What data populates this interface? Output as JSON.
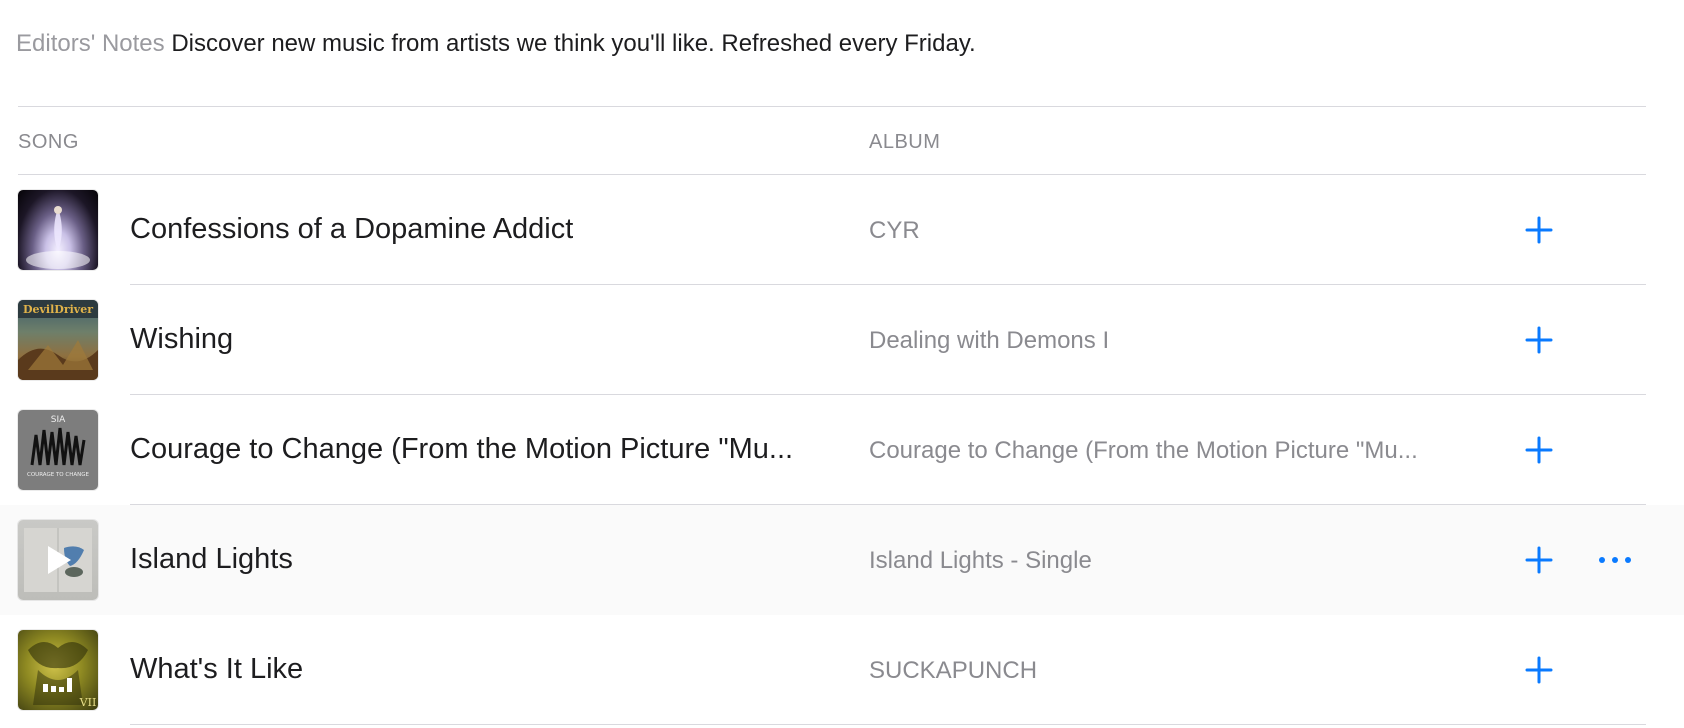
{
  "editors_notes": {
    "label": "Editors' Notes",
    "text": "Discover new music from artists we think you'll like. Refreshed every Friday."
  },
  "columns": {
    "song": "SONG",
    "album": "ALBUM"
  },
  "colors": {
    "accent": "#0a7aff",
    "secondary_text": "#8a8a8f",
    "separator": "#d9d9de",
    "hover_row": "#fafafa"
  },
  "tracks": [
    {
      "title": "Confessions of a Dopamine Addict",
      "album": "CYR",
      "art": "cyr",
      "hover": false
    },
    {
      "title": "Wishing",
      "album": "Dealing with Demons I",
      "art": "devildriver",
      "art_text": "DevilDriver",
      "hover": false
    },
    {
      "title": "Courage to Change (From the Motion Picture \"Mu...",
      "album": "Courage to Change (From the Motion Picture \"Mu...",
      "art": "sia",
      "art_text": "SIA",
      "art_subtext": "COURAGE TO CHANGE",
      "hover": false
    },
    {
      "title": "Island Lights",
      "album": "Island Lights - Single",
      "art": "island",
      "hover": true,
      "art_overlay": "play-icon"
    },
    {
      "title": "What's It Like",
      "album": "SUCKAPUNCH",
      "art": "suckapunch",
      "art_text": "VII",
      "hover": false,
      "art_overlay": "now-playing-bars-icon"
    }
  ],
  "icons": {
    "add": "plus-icon",
    "more": "ellipsis-icon",
    "play": "play-icon"
  }
}
